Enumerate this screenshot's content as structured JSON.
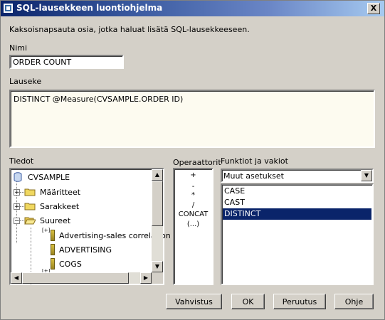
{
  "window": {
    "title": "SQL-lausekkeen luontiohjelma",
    "close_label": "X"
  },
  "intro": "Kaksoisnapsauta osia, jotka haluat lisätä SQL-lausekkeeseen.",
  "name_field": {
    "label": "Nimi",
    "value": "ORDER COUNT"
  },
  "expression": {
    "label": "Lauseke",
    "value": "DISTINCT @Measure(CVSAMPLE.ORDER ID)"
  },
  "data_panel": {
    "label": "Tiedot",
    "root": "CVSAMPLE",
    "folders": [
      {
        "label": "Määritteet",
        "expander": "+"
      },
      {
        "label": "Sarakkeet",
        "expander": "+"
      },
      {
        "label": "Suureet",
        "expander": "−"
      }
    ],
    "measures": [
      "Advertising-sales correlation",
      "ADVERTISING",
      "COGS"
    ],
    "measure_expander": "[+]"
  },
  "operators": {
    "label": "Operaattorit",
    "items": [
      "+",
      "-",
      "*",
      "/",
      "CONCAT",
      "(...)"
    ]
  },
  "functions": {
    "label": "Funktiot ja vakiot",
    "selected_category": "Muut asetukset",
    "items": [
      "CASE",
      "CAST",
      "DISTINCT"
    ],
    "selected_item": "DISTINCT"
  },
  "buttons": {
    "validate": "Vahvistus",
    "ok": "OK",
    "cancel": "Peruutus",
    "help": "Ohje"
  }
}
